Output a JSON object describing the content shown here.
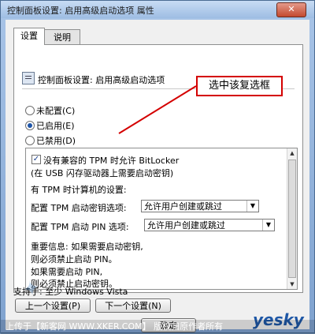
{
  "window": {
    "title": "控制面板设置: 启用高级启动选项 属性",
    "close_label": "✕"
  },
  "tabs": [
    {
      "label": "设置"
    },
    {
      "label": "说明"
    }
  ],
  "setting": {
    "title": "控制面板设置: 启用高级启动选项"
  },
  "radios": [
    {
      "label": "未配置(C)",
      "checked": false
    },
    {
      "label": "已启用(E)",
      "checked": true
    },
    {
      "label": "已禁用(D)",
      "checked": false
    }
  ],
  "options": {
    "checkbox_label": "没有兼容的 TPM 时允许 BitLocker",
    "checkbox_note": "(在 USB 闪存驱动器上需要启动密钥)",
    "section_label": "有 TPM 时计算机的设置:",
    "tpm_key_label": "配置 TPM 启动密钥选项:",
    "tpm_key_value": "允许用户创建或跳过",
    "tpm_pin_label": "配置 TPM 启动 PIN 选项:",
    "tpm_pin_value": "允许用户创建或跳过",
    "note_line1": "重要信息: 如果需要启动密钥,",
    "note_line2": "则必须禁止启动 PIN。",
    "note_line3": "如果需要启动 PIN,",
    "note_line4": "则必须禁止启动密钥。"
  },
  "supported_on": "支持于: 至少 Windows Vista",
  "buttons": {
    "previous": "上一个设置(P)",
    "next": "下一个设置(N)",
    "ok": "确定"
  },
  "callout": {
    "text": "选中该复选框",
    "color": "#d40000"
  },
  "footer": {
    "text": "上传于【新客网 WWW.XKER.COM】 版权归原作者所有"
  },
  "logo": {
    "text": "yesky",
    "sub": "天极网"
  }
}
